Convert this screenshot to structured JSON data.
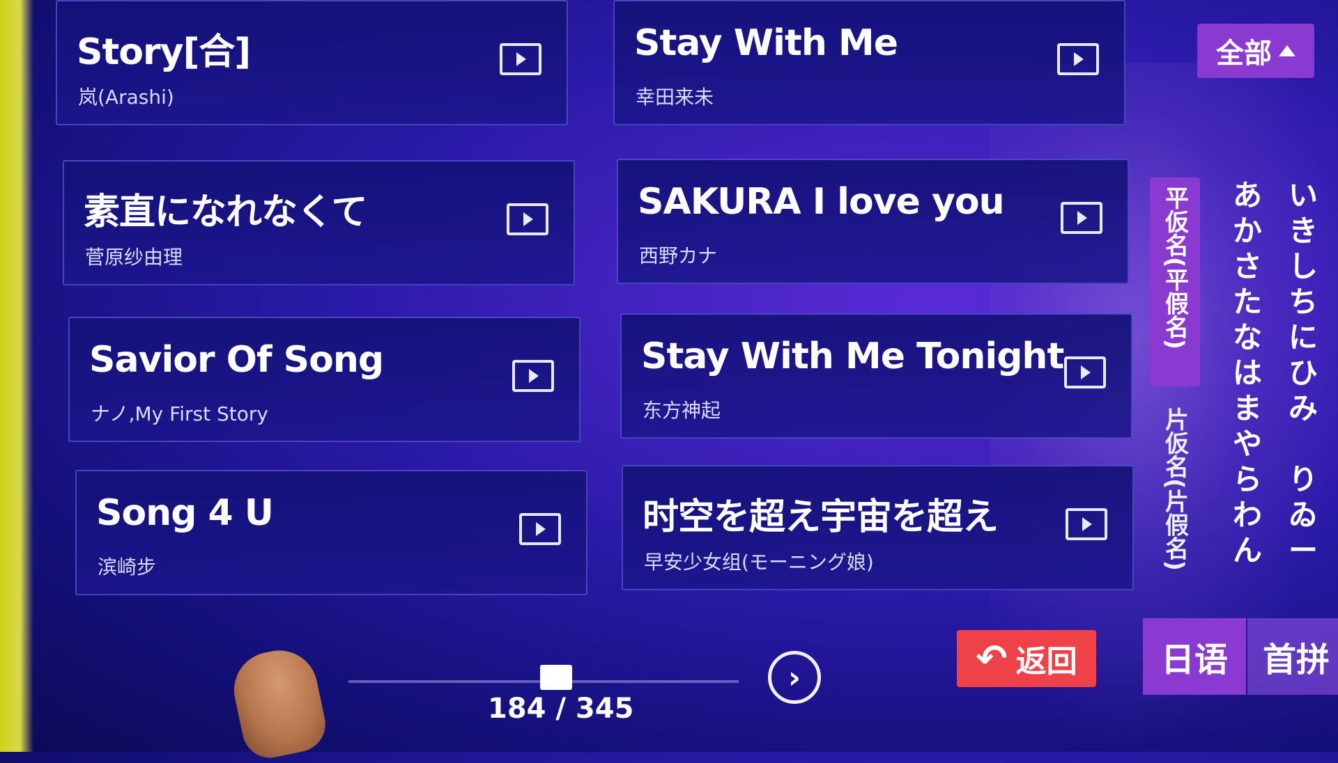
{
  "songs": [
    {
      "title": "Story[合]",
      "artist": "岚(Arashi)"
    },
    {
      "title": "Stay With Me",
      "artist": "幸田来未"
    },
    {
      "title": "素直になれなくて",
      "artist": "菅原纱由理"
    },
    {
      "title": "SAKURA I love you",
      "artist": "西野カナ"
    },
    {
      "title": "Savior Of Song",
      "artist": "ナノ,My First Story"
    },
    {
      "title": "Stay With Me Tonight",
      "artist": "东方神起"
    },
    {
      "title": "Song 4 U",
      "artist": "滨崎步"
    },
    {
      "title": "时空を超え宇宙を超え",
      "artist": "早安少女组(モーニング娘)"
    }
  ],
  "filter": {
    "all_label": "全部"
  },
  "kana": {
    "hiragana_tab": "平仮名(平假名)",
    "katakana_tab": "片仮名(片假名)",
    "column1": [
      "あ",
      "か",
      "さ",
      "た",
      "な",
      "は",
      "ま",
      "や",
      "ら",
      "わ",
      "ん"
    ],
    "column2": [
      "い",
      "き",
      "し",
      "ち",
      "に",
      "ひ",
      "み",
      "",
      "り",
      "ゐ",
      "ー"
    ]
  },
  "pager": {
    "current": "184",
    "total": "345",
    "display": "184 / 345",
    "position": 0.533
  },
  "buttons": {
    "back_label": "返回",
    "japanese_label": "日语",
    "pinyin_label": "首拼"
  },
  "colors": {
    "accent_purple": "#8a3ad1",
    "back_red": "#ef4148",
    "background": "#2a1aa8"
  }
}
